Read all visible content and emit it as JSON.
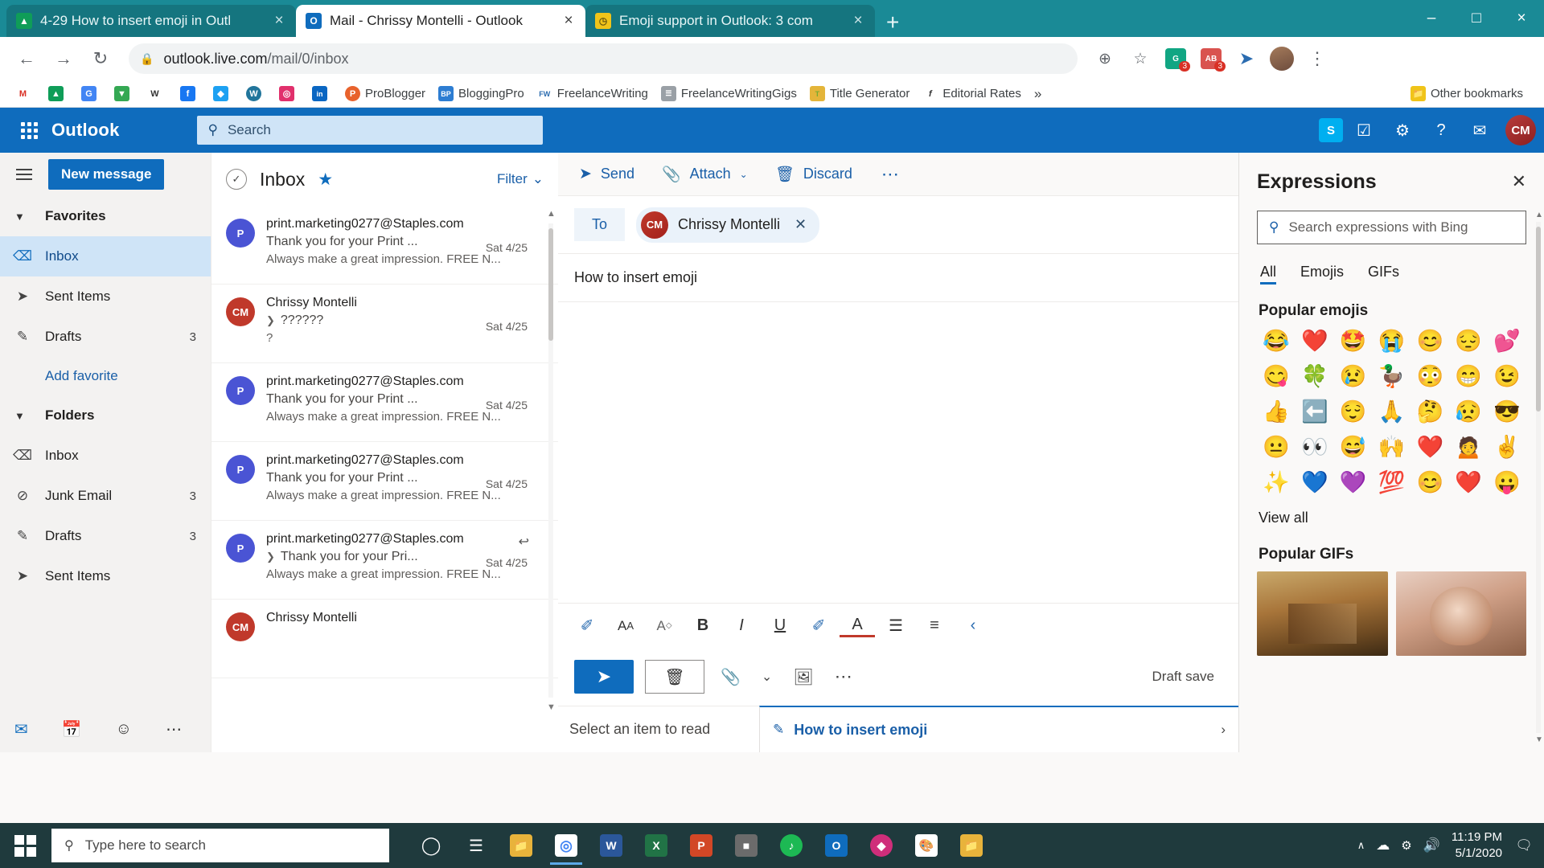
{
  "browser": {
    "tabs": [
      {
        "title": "4-29 How to insert emoji in Outl",
        "favicon": "google-drive-icon",
        "active": false,
        "close_label": "×"
      },
      {
        "title": "Mail - Chrissy Montelli - Outlook",
        "favicon": "outlook-icon",
        "active": true,
        "close_label": "×"
      },
      {
        "title": "Emoji support in Outlook: 3 com",
        "favicon": "clock-icon",
        "active": false,
        "close_label": "×"
      }
    ],
    "new_tab_label": "+",
    "window_controls": {
      "minimize": "–",
      "maximize": "□",
      "close": "×"
    },
    "nav": {
      "back": "←",
      "forward": "→",
      "reload": "↻"
    },
    "omnibox": {
      "lock_icon": "lock-icon",
      "url_main": "outlook.live.com",
      "url_path": "/mail/0/inbox"
    },
    "toolbar_icons": [
      {
        "name": "install-app-icon",
        "glyph": "⊕"
      },
      {
        "name": "bookmark-star-icon",
        "glyph": "☆"
      },
      {
        "name": "extension-grammarly-icon",
        "glyph": "G",
        "color": "#11a683",
        "count": "3"
      },
      {
        "name": "extension-ablebits-icon",
        "glyph": "AB",
        "color": "#d9534f",
        "count": "3"
      },
      {
        "name": "extension-share-icon",
        "glyph": "➤",
        "color": "#2b6cb0"
      }
    ],
    "profile_avatar": "chrome-profile-avatar",
    "menu_icon": "kebab-menu-icon",
    "bookmarks": [
      {
        "label": "",
        "icon": "gmail-icon",
        "glyph": "M",
        "color": "#ffffff",
        "text": "#d93025"
      },
      {
        "label": "",
        "icon": "google-drive-icon",
        "glyph": "▲",
        "color": "#0f9d58"
      },
      {
        "label": "",
        "icon": "google-translate-icon",
        "glyph": "G",
        "color": "#4285f4"
      },
      {
        "label": "",
        "icon": "google-maps-icon",
        "glyph": "▼",
        "color": "#34a853"
      },
      {
        "label": "",
        "icon": "wikipedia-icon",
        "glyph": "W",
        "color": "#ffffff",
        "text": "#333"
      },
      {
        "label": "",
        "icon": "facebook-icon",
        "glyph": "f",
        "color": "#1877f2"
      },
      {
        "label": "",
        "icon": "twitter-icon",
        "glyph": "◆",
        "color": "#1da1f2"
      },
      {
        "label": "",
        "icon": "wordpress-icon",
        "glyph": "W",
        "color": "#21759b"
      },
      {
        "label": "",
        "icon": "instagram-icon",
        "glyph": "◎",
        "color": "#e1306c"
      },
      {
        "label": "",
        "icon": "linkedin-icon",
        "glyph": "in",
        "color": "#0a66c2"
      },
      {
        "label": "ProBlogger",
        "icon": "problogger-icon",
        "glyph": "P",
        "color": "#e8622c"
      },
      {
        "label": "BloggingPro",
        "icon": "bloggingpro-icon",
        "glyph": "BP",
        "color": "#2d7dd2"
      },
      {
        "label": "FreelanceWriting",
        "icon": "freelancewriting-icon",
        "glyph": "FW",
        "color": "#ffffff",
        "text": "#2b6cb0"
      },
      {
        "label": "FreelanceWritingGigs",
        "icon": "freelancewritinggigs-icon",
        "glyph": "☰",
        "color": "#888"
      },
      {
        "label": "Title Generator",
        "icon": "title-generator-icon",
        "glyph": "T",
        "color": "#e4b53a"
      },
      {
        "label": "Editorial Rates",
        "icon": "editorial-rates-icon",
        "glyph": "f",
        "color": "#ffffff",
        "text": "#333"
      }
    ],
    "bookmarks_overflow": "»",
    "other_bookmarks": {
      "label": "Other bookmarks",
      "icon": "folder-icon"
    }
  },
  "outlook": {
    "waffle_icon": "app-launcher-icon",
    "brand": "Outlook",
    "search": {
      "placeholder": "Search",
      "icon": "search-icon"
    },
    "header_icons": [
      {
        "name": "skype-icon",
        "glyph": "S"
      },
      {
        "name": "tasks-icon",
        "glyph": "✓"
      },
      {
        "name": "settings-gear-icon",
        "glyph": "⚙"
      },
      {
        "name": "help-icon",
        "glyph": "?"
      },
      {
        "name": "feedback-icon",
        "glyph": "✉"
      }
    ],
    "user_initials": "CM"
  },
  "sidebar": {
    "hamburger_icon": "hamburger-menu-icon",
    "new_message_label": "New message",
    "favorites_label": "Favorites",
    "favorites": [
      {
        "label": "Inbox",
        "icon": "inbox-icon",
        "count": "",
        "selected": true
      },
      {
        "label": "Sent Items",
        "icon": "sent-icon",
        "count": "",
        "selected": false
      },
      {
        "label": "Drafts",
        "icon": "drafts-pencil-icon",
        "count": "3",
        "selected": false
      }
    ],
    "add_favorite_label": "Add favorite",
    "folders_label": "Folders",
    "folders": [
      {
        "label": "Inbox",
        "icon": "inbox-icon",
        "count": "",
        "selected": false
      },
      {
        "label": "Junk Email",
        "icon": "junk-icon",
        "count": "3",
        "selected": false
      },
      {
        "label": "Drafts",
        "icon": "drafts-pencil-icon",
        "count": "3",
        "selected": false
      },
      {
        "label": "Sent Items",
        "icon": "sent-icon",
        "count": "",
        "selected": false
      }
    ],
    "bottom_nav": [
      {
        "name": "mail-nav-icon",
        "glyph": "✉"
      },
      {
        "name": "calendar-nav-icon",
        "glyph": "Ὄ5"
      },
      {
        "name": "people-nav-icon",
        "glyph": "☺"
      },
      {
        "name": "more-nav-icon",
        "glyph": "⋯"
      }
    ]
  },
  "message_list": {
    "select_all_icon": "circle-check-icon",
    "title": "Inbox",
    "star_icon": "star-icon",
    "filter_label": "Filter",
    "filter_chevron": "⌄",
    "messages": [
      {
        "sender": "print.marketing0277@Staples.com",
        "subject": "Thank you for your Print ...",
        "preview": "Always make a great impression. FREE N...",
        "date": "Sat 4/25",
        "avatar_initial": "P",
        "avatar_color": "#4a54d4",
        "has_caret": false,
        "has_reply": false
      },
      {
        "sender": "Chrissy Montelli",
        "subject": "??????",
        "preview": "?",
        "date": "Sat 4/25",
        "avatar_initial": "CM",
        "avatar_color": "#c0392b",
        "has_caret": true,
        "has_reply": false
      },
      {
        "sender": "print.marketing0277@Staples.com",
        "subject": "Thank you for your Print ...",
        "preview": "Always make a great impression. FREE N...",
        "date": "Sat 4/25",
        "avatar_initial": "P",
        "avatar_color": "#4a54d4",
        "has_caret": false,
        "has_reply": false
      },
      {
        "sender": "print.marketing0277@Staples.com",
        "subject": "Thank you for your Print ...",
        "preview": "Always make a great impression. FREE N...",
        "date": "Sat 4/25",
        "avatar_initial": "P",
        "avatar_color": "#4a54d4",
        "has_caret": false,
        "has_reply": false
      },
      {
        "sender": "print.marketing0277@Staples.com",
        "subject": "Thank you for your Pri...",
        "preview": "Always make a great impression. FREE N...",
        "date": "Sat 4/25",
        "avatar_initial": "P",
        "avatar_color": "#4a54d4",
        "has_caret": true,
        "has_reply": true
      },
      {
        "sender": "Chrissy Montelli",
        "subject": "",
        "preview": "",
        "date": "",
        "avatar_initial": "CM",
        "avatar_color": "#c0392b",
        "has_caret": false,
        "has_reply": false
      }
    ]
  },
  "compose": {
    "commands": [
      {
        "label": "Send",
        "icon": "send-arrow-icon",
        "glyph": "➤",
        "chevron": ""
      },
      {
        "label": "Attach",
        "icon": "paperclip-icon",
        "glyph": "📎",
        "chevron": "⌄"
      },
      {
        "label": "Discard",
        "icon": "trash-icon",
        "glyph": "🗑",
        "chevron": ""
      }
    ],
    "more_commands": "⋯",
    "to_label": "To",
    "recipient": {
      "name": "Chrissy Montelli",
      "initials": "CM",
      "remove_icon": "remove-recipient-icon",
      "remove_glyph": "✕"
    },
    "subject": "How to insert emoji",
    "body": "",
    "format_tools": [
      {
        "name": "format-painter-icon",
        "glyph": "✒"
      },
      {
        "name": "font-size-icon",
        "glyph": "AA"
      },
      {
        "name": "font-color-style-icon",
        "glyph": "A◇"
      },
      {
        "name": "bold-icon",
        "glyph": "B"
      },
      {
        "name": "italic-icon",
        "glyph": "I"
      },
      {
        "name": "underline-icon",
        "glyph": "U"
      },
      {
        "name": "highlight-icon",
        "glyph": "✐"
      },
      {
        "name": "font-color-icon",
        "glyph": "A"
      },
      {
        "name": "bullet-list-icon",
        "glyph": "☰"
      },
      {
        "name": "numbered-list-icon",
        "glyph": "≡"
      },
      {
        "name": "more-format-icon",
        "glyph": "‹"
      }
    ],
    "send_button": {
      "name": "send-button",
      "glyph": "➤"
    },
    "discard_button": {
      "name": "discard-button",
      "glyph": "🗑"
    },
    "attach_icon": {
      "name": "attach-icon",
      "glyph": "📎"
    },
    "attach_chevron": "⌄",
    "image_icon": {
      "name": "insert-picture-icon",
      "glyph": "🏔"
    },
    "more_icon": "⋯",
    "draft_status": "Draft save"
  },
  "bottom_strip": {
    "read_placeholder": "Select an item to read",
    "mini_compose": {
      "pencil_icon": "pencil-icon",
      "title": "How to insert emoji",
      "close_icon": "close-mini-compose-icon",
      "close_glyph": "›"
    }
  },
  "expressions": {
    "title": "Expressions",
    "close_icon": "close-panel-icon",
    "close_glyph": "✕",
    "search": {
      "placeholder": "Search expressions with Bing",
      "icon": "search-icon"
    },
    "tabs": [
      {
        "label": "All",
        "active": true
      },
      {
        "label": "Emojis",
        "active": false
      },
      {
        "label": "GIFs",
        "active": false
      }
    ],
    "popular_emojis_label": "Popular emojis",
    "emojis": [
      "😂",
      "❤️",
      "🤩",
      "😭",
      "😊",
      "😔",
      "💕",
      "😋",
      "🍀",
      "😢",
      "🦆",
      "😳",
      "😁",
      "😉",
      "👍",
      "⬅️",
      "😌",
      "🙏",
      "🤔",
      "😥",
      "😎",
      "😐",
      "👀",
      "😅",
      "🙌",
      "❤️",
      "🙍",
      "✌️",
      "✨",
      "💙",
      "💜",
      "💯",
      "😊",
      "❤️",
      "😛"
    ],
    "view_all_label": "View all",
    "popular_gifs_label": "Popular GIFs",
    "gifs": [
      {
        "name": "gif-thumbnail-1"
      },
      {
        "name": "gif-thumbnail-2"
      }
    ]
  },
  "taskbar": {
    "start_icon": "windows-start-icon",
    "search": {
      "placeholder": "Type here to search",
      "icon": "search-icon"
    },
    "cortana_icon": "cortana-circle-icon",
    "taskview_icon": "task-view-icon",
    "apps": [
      {
        "name": "file-explorer-taskbar-icon",
        "glyph": "📁",
        "color": "#e8b33b",
        "active": false
      },
      {
        "name": "chrome-taskbar-icon",
        "glyph": "◎",
        "color": "#4285f4",
        "active": true
      },
      {
        "name": "word-taskbar-icon",
        "glyph": "W",
        "color": "#2b579a",
        "active": false
      },
      {
        "name": "excel-taskbar-icon",
        "glyph": "X",
        "color": "#217346",
        "active": false
      },
      {
        "name": "powerpoint-taskbar-icon",
        "glyph": "P",
        "color": "#d24726",
        "active": false
      },
      {
        "name": "calculator-taskbar-icon",
        "glyph": "⌗",
        "color": "#5a5a5a",
        "active": false
      },
      {
        "name": "spotify-taskbar-icon",
        "glyph": "♫",
        "color": "#1db954",
        "active": false
      },
      {
        "name": "outlook-taskbar-icon",
        "glyph": "O",
        "color": "#0f6cbd",
        "active": false
      },
      {
        "name": "adobe-taskbar-icon",
        "glyph": "◆",
        "color": "#cf2e7a",
        "active": false
      },
      {
        "name": "paint-taskbar-icon",
        "glyph": "🎨",
        "color": "#ffffff",
        "active": false
      },
      {
        "name": "folder-taskbar-icon",
        "glyph": "📁",
        "color": "#e8b33b",
        "active": false
      }
    ],
    "tray": {
      "overflow_glyph": "∧",
      "onedrive_icon": "onedrive-tray-icon",
      "network_icon": "network-tray-icon",
      "volume_icon": "volume-tray-icon",
      "time": "11:19 PM",
      "date": "5/1/2020",
      "notification_icon": "action-center-icon"
    }
  }
}
